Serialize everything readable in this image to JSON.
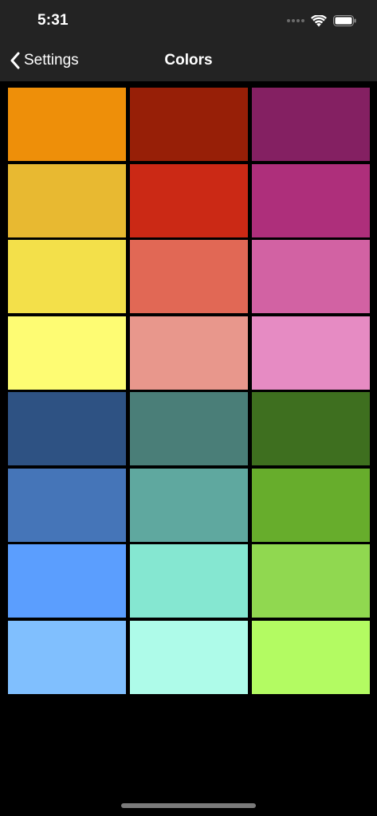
{
  "status_bar": {
    "time": "5:31"
  },
  "nav": {
    "back_label": "Settings",
    "title": "Colors"
  },
  "icons": {
    "back": "chevron-left-icon",
    "wifi": "wifi-icon",
    "battery": "battery-icon",
    "signal": "signal-dots-icon"
  },
  "colors": {
    "bar_background": "#232323",
    "screen_background": "#000000",
    "foreground": "#ffffff"
  },
  "swatches": [
    "#ee8f09",
    "#971f07",
    "#842062",
    "#e8b931",
    "#cb2915",
    "#ae2f7b",
    "#f3e04a",
    "#e16855",
    "#d262a3",
    "#fefc73",
    "#e8978c",
    "#e68bc3",
    "#2e5283",
    "#4a7e78",
    "#3e6f1f",
    "#4575b8",
    "#5fa89f",
    "#67ad2c",
    "#5b9efe",
    "#85e7d1",
    "#90d850",
    "#80bffe",
    "#aefbe9",
    "#b3fb62"
  ]
}
